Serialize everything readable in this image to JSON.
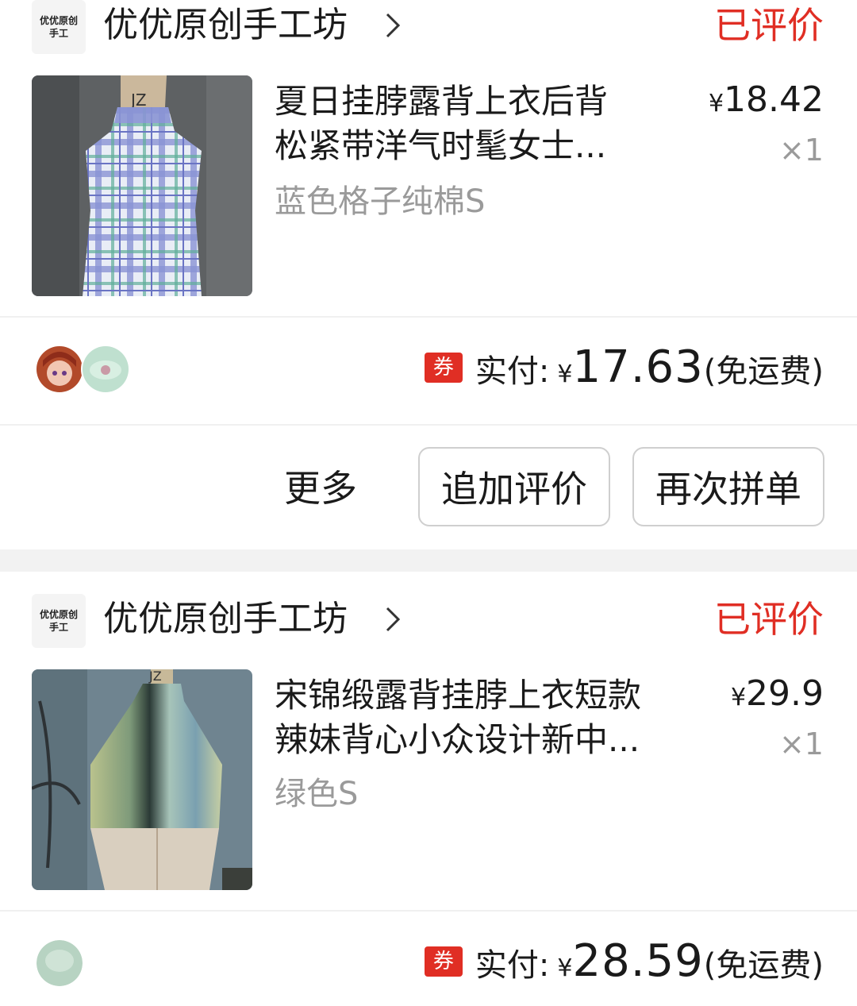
{
  "orders": [
    {
      "shop": {
        "logo_text": "优优原创\n手工",
        "name": "优优原创手工坊"
      },
      "status": "已评价",
      "item": {
        "title_line1": "夏日挂脖露背上衣后背",
        "title_line2": "松紧带洋气时髦女士...",
        "spec": "蓝色格子纯棉S",
        "currency": "¥",
        "price": "18.42",
        "qty": "×1"
      },
      "payment": {
        "coupon": "券",
        "label": "实付:",
        "currency": "¥",
        "amount": "17.63",
        "note": "(免运费)"
      },
      "actions": {
        "more": "更多",
        "add_review": "追加评价",
        "reorder": "再次拼单"
      }
    },
    {
      "shop": {
        "logo_text": "优优原创\n手工",
        "name": "优优原创手工坊"
      },
      "status": "已评价",
      "item": {
        "title_line1": "宋锦缎露背挂脖上衣短款",
        "title_line2": "辣妹背心小众设计新中...",
        "spec": "绿色S",
        "currency": "¥",
        "price": "29.9",
        "qty": "×1"
      },
      "payment": {
        "coupon": "券",
        "label": "实付:",
        "currency": "¥",
        "amount": "28.59",
        "note": "(免运费)"
      }
    }
  ],
  "colors": {
    "accent_red": "#e02e24",
    "muted_text": "#9a9a9a"
  },
  "icons": {
    "shop_chevron": "chevron-right-icon"
  }
}
